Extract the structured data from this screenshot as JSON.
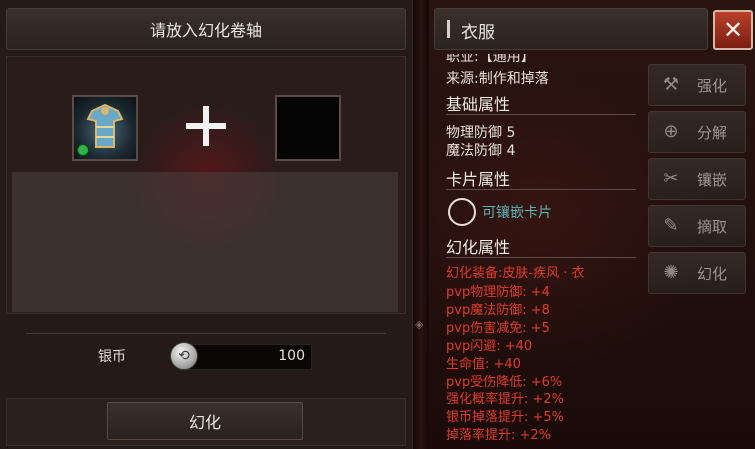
{
  "left": {
    "title": "请放入幻化卷轴",
    "currency_label": "银币",
    "currency_value": "100",
    "transform_button": "幻化"
  },
  "item": {
    "name": "衣服",
    "close_symbol": "✕",
    "partial_line": "职业:【通用】",
    "source": "来源:制作和掉落",
    "basic_header": "基础属性",
    "basic_stats": [
      "物理防御 5",
      "魔法防御 4"
    ],
    "card_header": "卡片属性",
    "card_slot_text": "可镶嵌卡片",
    "transform_header": "幻化属性",
    "transform_stats": [
      "幻化装备:皮肤-疾风 · 衣",
      "pvp物理防御: +4",
      "pvp魔法防御: +8",
      "pvp伤害减免: +5",
      "pvp闪避: +40",
      "生命值: +40",
      "pvp受伤降低: +6%",
      "强化概率提升: +2%",
      "银币掉落提升: +5%",
      "掉落率提升: +2%"
    ]
  },
  "actions": [
    {
      "label": "强化",
      "icon": "hammer-icon",
      "glyph": "⚒"
    },
    {
      "label": "分解",
      "icon": "crosshair-icon",
      "glyph": "⊕"
    },
    {
      "label": "镶嵌",
      "icon": "tools-icon",
      "glyph": "✂"
    },
    {
      "label": "摘取",
      "icon": "pick-icon",
      "glyph": "✎"
    },
    {
      "label": "幻化",
      "icon": "swirl-icon",
      "glyph": "✺"
    }
  ],
  "colors": {
    "accent_red": "#e03a2a",
    "card_text": "#5ab4b8",
    "close_button": "#b8402a",
    "gem_green": "#33b24a"
  }
}
